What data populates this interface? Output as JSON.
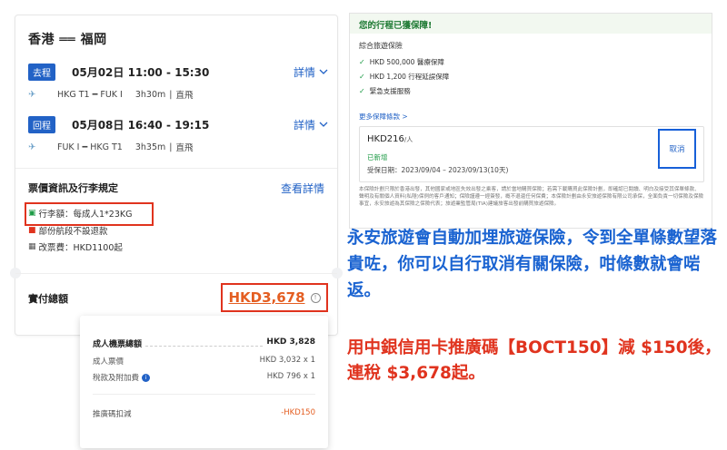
{
  "flight": {
    "route": "香港 ══ 福岡",
    "outbound": {
      "tag": "去程",
      "datetime": "05月02日 11:00 - 15:30",
      "detail_link": "詳情",
      "segment": "HKG T1 ━ FUK I",
      "duration": "3h30m",
      "sep": "|",
      "type": "直飛"
    },
    "inbound": {
      "tag": "回程",
      "datetime": "05月08日 16:40 - 19:15",
      "detail_link": "詳情",
      "segment": "FUK I ━ HKG T1",
      "duration": "3h35m",
      "sep": "|",
      "type": "直飛"
    },
    "ticket_title": "票價資訊及行李規定",
    "ticket_link": "查看詳情",
    "baggage": "行李額：每成人1*23KG",
    "refund": "部份航段不設退款",
    "change_fee": "改票費：HKD1100起",
    "total_label": "實付總額",
    "total_amount": "HKD3,678",
    "info_glyph": "!"
  },
  "breakdown": {
    "adult_total_label": "成人機票總額",
    "adult_total_value": "HKD 3,828",
    "adult_fare_label": "成人票價",
    "adult_fare_value": "HKD 3,032 x 1",
    "tax_label": "稅款及附加費",
    "tax_value": "HKD 796 x 1",
    "promo_label": "推廣碼扣減",
    "promo_value": "-HKD150"
  },
  "insurance": {
    "header": "您的行程已獲保障!",
    "section": "綜合旅遊保險",
    "features": [
      "HKD 500,000 醫療保障",
      "HKD 1,200 行程延誤保障",
      "緊急支援服務"
    ],
    "more_terms": "更多保障條款 >",
    "price": "HKD216",
    "per": "/人",
    "status": "已新增",
    "period": "受保日期：2023/09/04 – 2023/09/13(10天)",
    "cancel": "取消",
    "fine_print": "本保險計劃只限於香港出發，其他國家或地區失效出發之乘客，請於當地購買保險；若需下載購買此保險計劃，即確認已閱讀、明白及接受其保單條款、聲明及有關個人資料(私隱)保例的客戶通知；保險謹遵一經簽發，概不退還任何保費；本保險計劃由永安旅遊保險有限公司承保，全面負責一切保險及保險事宜，永安旅遊為其保險之保險代表；旅遊業監管局(TIA)建議旅客出發前購買旅遊保險。"
  },
  "promo_text": {
    "blue": "永安旅遊會自動加埋旅遊保險，令到全單條數望落貴咗，你可以自行取消有關保險，咁條數就會啱返。",
    "red": "用中銀信用卡推廣碼【BOCT150】減 $150後，連稅 $3,678起。"
  },
  "colors": {
    "brand_blue": "#2262c6",
    "highlight_red": "#e0331e",
    "price_orange": "#e45e22",
    "success_green": "#1e9b46"
  }
}
